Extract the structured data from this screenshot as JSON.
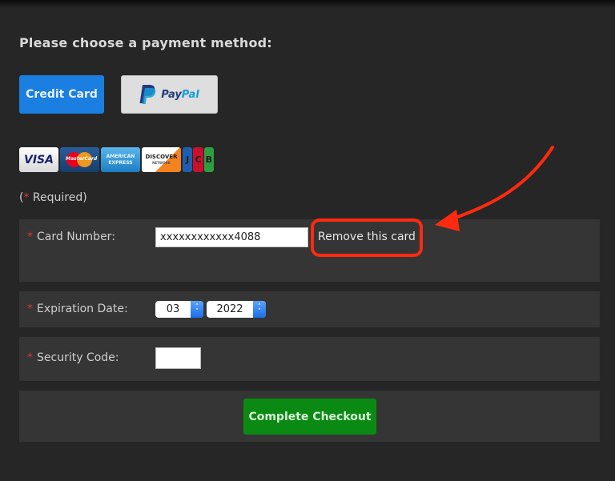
{
  "heading": "Please choose a payment method:",
  "payment_methods": {
    "credit_card_label": "Credit Card",
    "paypal": {
      "pay": "Pay",
      "pal": "Pal"
    }
  },
  "accepted_cards": {
    "visa": "VISA",
    "mastercard": "MasterCard",
    "amex_line1": "AMERICAN",
    "amex_line2": "EXPRESS",
    "discover": "DISCOVER",
    "discover_sub": "NETWORK",
    "jcb": [
      "J",
      "C",
      "B"
    ]
  },
  "required_note": {
    "open": "(",
    "star": "*",
    "text": " Required)"
  },
  "form": {
    "card_number": {
      "label": "Card Number:",
      "value": "xxxxxxxxxxxx4088",
      "remove_label": "Remove this card"
    },
    "expiration": {
      "label": "Expiration Date:",
      "month": "03",
      "year": "2022"
    },
    "security_code": {
      "label": "Security Code:",
      "value": ""
    },
    "required_star": "*"
  },
  "checkout_label": "Complete Checkout",
  "colors": {
    "credit_card_button": "#1a7fe0",
    "checkout_button": "#0a8a12",
    "annotation_red": "#ff2a10",
    "required_star": "#d43a2a"
  }
}
